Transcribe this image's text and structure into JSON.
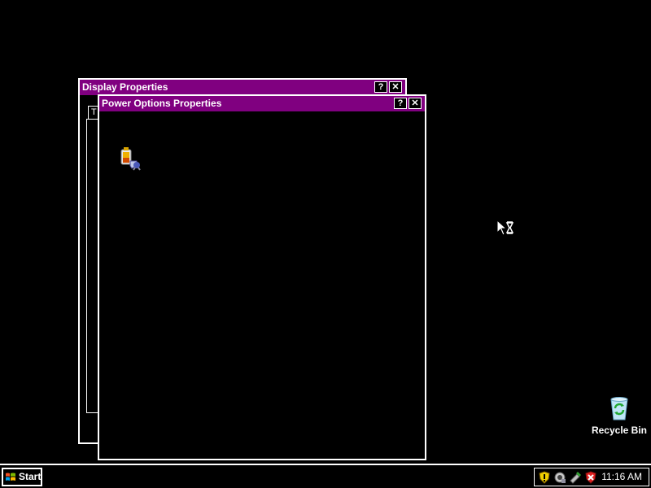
{
  "windows": {
    "display": {
      "title": "Display Properties",
      "help_label": "?",
      "close_label": "✕",
      "tab_label": "T"
    },
    "power": {
      "title": "Power Options Properties",
      "help_label": "?",
      "close_label": "✕",
      "icon": "power-options-icon"
    }
  },
  "desktop": {
    "recycle_bin_label": "Recycle Bin"
  },
  "taskbar": {
    "start_label": "Start",
    "tray_icons": [
      "security-shield-icon",
      "network-icon",
      "safely-remove-hardware-icon",
      "security-alert-icon"
    ],
    "clock": "11:16 AM"
  },
  "colors": {
    "background": "#000000",
    "titlebar": "#800080",
    "foreground": "#ffffff"
  }
}
